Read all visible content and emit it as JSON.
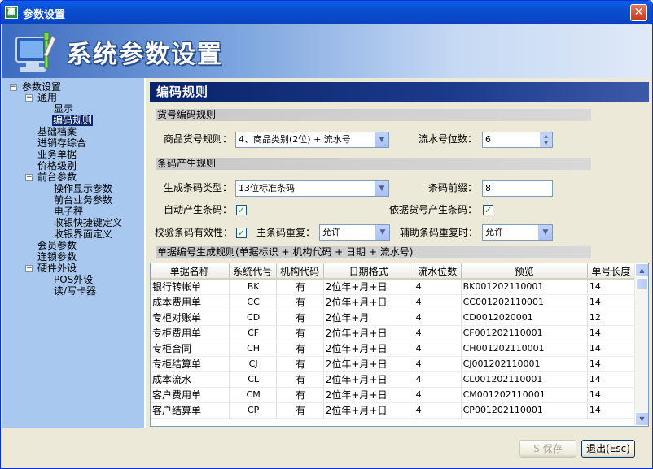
{
  "window": {
    "title": "参数设置",
    "app_icon": "赢",
    "close_glyph": "✕"
  },
  "banner": {
    "title": "系统参数设置"
  },
  "tree": {
    "root": "参数设置",
    "general": "通用",
    "display": "显示",
    "coding_rules": "编码规则",
    "basic_files": "基础档案",
    "pss": "进销存综合",
    "business_docs": "业务单据",
    "price_level": "价格级别",
    "front_params": "前台参数",
    "op_display": "操作显示参数",
    "front_business": "前台业务参数",
    "scale": "电子秤",
    "cashier_hotkeys": "收银快捷键定义",
    "cashier_ui": "收银界面定义",
    "member_params": "会员参数",
    "chain_params": "连锁参数",
    "hardware": "硬件外设",
    "pos": "POS外设",
    "card_reader": "读/写卡器"
  },
  "panel": {
    "header": "编码规则",
    "goods_section": "货号编码规则",
    "goods_rule_label": "商品货号规则：",
    "goods_rule_value": "4、商品类别(2位) + 流水号",
    "serial_digits_label": "流水号位数：",
    "serial_digits_value": "6",
    "barcode_section": "条码产生规则",
    "barcode_type_label": "生成条码类型：",
    "barcode_type_value": "13位标准条码",
    "barcode_prefix_label": "条码前缀：",
    "barcode_prefix_value": "8",
    "auto_barcode_label": "自动产生条码：",
    "by_goods_no_label": "依据货号产生条码：",
    "validate_label": "校验条码有效性：",
    "main_dup_label": "主条码重复：",
    "main_dup_value": "允许",
    "aux_dup_label": "辅助条码重复时：",
    "aux_dup_value": "允许",
    "doc_section": "单据编号生成规则(单据标识 + 机构代码 + 日期 + 流水号)"
  },
  "table": {
    "columns": [
      "单据名称",
      "系统代号",
      "机构代码",
      "日期格式",
      "流水位数",
      "预览",
      "单号长度"
    ],
    "rows": [
      [
        "银行转帐单",
        "BK",
        "有",
        "2位年+月+日",
        "4",
        "BK001202110001",
        "14"
      ],
      [
        "成本费用单",
        "CC",
        "有",
        "2位年+月+日",
        "4",
        "CC001202110001",
        "14"
      ],
      [
        "专柜对账单",
        "CD",
        "有",
        "2位年+月",
        "4",
        "CD0012020001",
        "12"
      ],
      [
        "专柜费用单",
        "CF",
        "有",
        "2位年+月+日",
        "4",
        "CF001202110001",
        "14"
      ],
      [
        "专柜合同",
        "CH",
        "有",
        "2位年+月+日",
        "4",
        "CH001202110001",
        "14"
      ],
      [
        "专柜结算单",
        "CJ",
        "有",
        "2位年+月+日",
        "4",
        "CJ001202110001",
        "14"
      ],
      [
        "成本流水",
        "CL",
        "有",
        "2位年+月+日",
        "4",
        "CL001202110001",
        "14"
      ],
      [
        "客户费用单",
        "CM",
        "有",
        "2位年+月+日",
        "4",
        "CM001202110001",
        "14"
      ],
      [
        "客户结算单",
        "CP",
        "有",
        "2位年+月+日",
        "4",
        "CP001202110001",
        "14"
      ]
    ]
  },
  "footer": {
    "save_label": "S 保存",
    "exit_label": "退出(Esc)"
  },
  "colors": {
    "title_bar": "#0a4fd0",
    "header": "#0a246a",
    "tree_bg": "#a8c8f0"
  }
}
